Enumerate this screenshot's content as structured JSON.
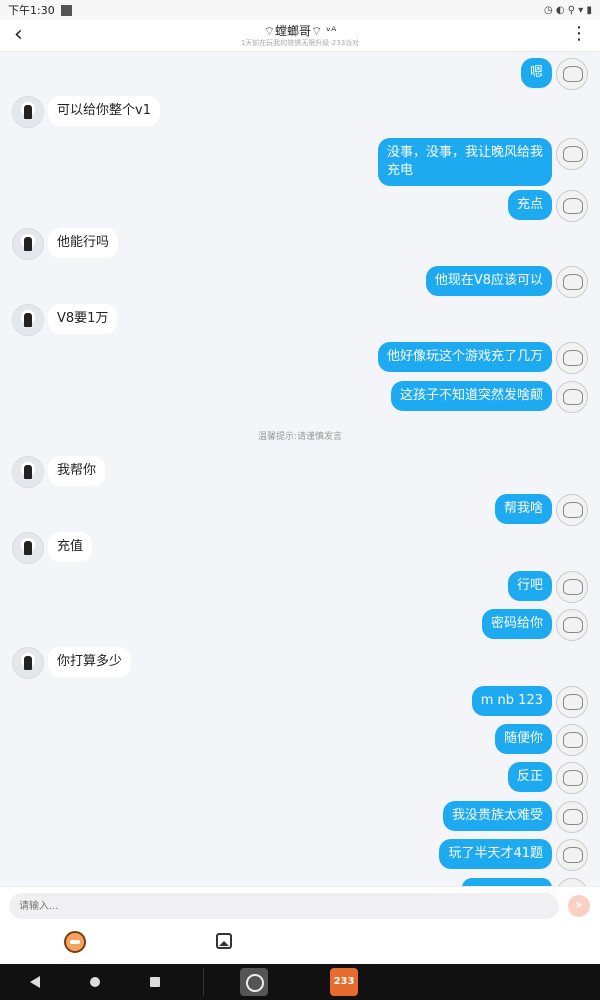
{
  "status_bar": {
    "time": "下午1:30",
    "icons": "◷ ◐ ⚲ ▾ ▮"
  },
  "header": {
    "title": "⌔螳螂哥⌔ ᵛᴬ",
    "subtitle": "1天前在玩我的铁锈无限升级-233派对"
  },
  "messages": [
    {
      "side": "right",
      "text": "嗯"
    },
    {
      "side": "left",
      "text": "可以给你整个v1"
    },
    {
      "side": "right",
      "text": "没事，没事，我让晚风给我充电"
    },
    {
      "side": "right",
      "text": "充点"
    },
    {
      "side": "left",
      "text": "他能行吗"
    },
    {
      "side": "right",
      "text": "他现在V8应该可以"
    },
    {
      "side": "left",
      "text": "V8要1万"
    },
    {
      "side": "right",
      "text": "他好像玩这个游戏充了几万"
    },
    {
      "side": "right",
      "text": "这孩子不知道突然发啥颠"
    },
    {
      "side": "left",
      "text": "我帮你"
    },
    {
      "side": "right",
      "text": "帮我啥"
    },
    {
      "side": "left",
      "text": "充值"
    },
    {
      "side": "right",
      "text": "行吧"
    },
    {
      "side": "right",
      "text": "密码给你"
    },
    {
      "side": "left",
      "text": "你打算多少"
    },
    {
      "side": "right",
      "text": "m nb 123"
    },
    {
      "side": "right",
      "text": "随便你"
    },
    {
      "side": "right",
      "text": "反正"
    },
    {
      "side": "right",
      "text": "我没贵族太难受"
    },
    {
      "side": "right",
      "text": "玩了半天才41题"
    }
  ],
  "tip": "温馨提示:请谨慎发言",
  "input": {
    "placeholder": "请输入..."
  },
  "nav": {
    "app_233": "233"
  }
}
